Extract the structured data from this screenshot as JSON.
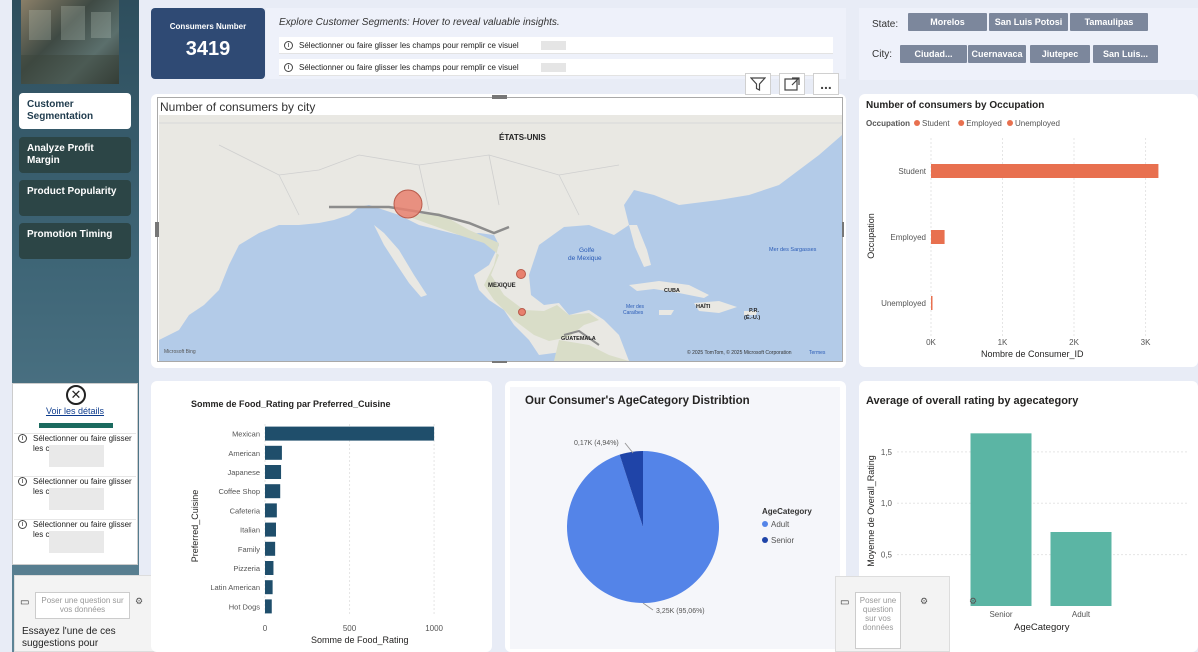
{
  "sidebar": {
    "nav": [
      {
        "label": "Customer Segmentation"
      },
      {
        "label": "Analyze Profit Margin"
      },
      {
        "label": "Product Popularity"
      },
      {
        "label": "Promotion Timing"
      }
    ],
    "details_link": "Voir les détails",
    "details_items": [
      "Sélectionner ou faire glisser les ch plir ce visu",
      "Sélectionner ou faire glisser les ch plir ce visu",
      "Sélectionner ou faire glisser les ch plir ce visu"
    ]
  },
  "kpi": {
    "label": "Consumers Number",
    "value": "3419"
  },
  "explore": {
    "text": "Explore Customer Segments: Hover to reveal valuable insights.",
    "rows": [
      "Sélectionner ou faire glisser les champs pour remplir ce visuel",
      "Sélectionner ou faire glisser les champs pour remplir ce visuel"
    ]
  },
  "slicers": {
    "state_label": "State:",
    "states": [
      "Morelos",
      "San Luis Potosi",
      "Tamaulipas"
    ],
    "city_label": "City:",
    "cities": [
      "Ciudad...",
      "Cuernavaca",
      "Jiutepec",
      "San Luis..."
    ]
  },
  "map": {
    "title": "Number of consumers by city",
    "labels": {
      "usa": "ÉTATS-UNIS",
      "mexico": "MEXIQUE",
      "cuba": "CUBA",
      "haiti": "HAÏTI",
      "pr": "P.R.",
      "pr2": "(É.-U.)",
      "guatemala": "GUATEMALA",
      "gulf1": "Golfe",
      "gulf2": "de Mexique",
      "sargasso": "Mer des Sargasses",
      "caribbean1": "Mer des",
      "caribbean2": "Caraïbes",
      "attribution": "© 2025 TomTom, © 2025 Microsoft Corporation",
      "terms": "Termes",
      "bing": "Microsoft Bing"
    },
    "toolbar": {
      "filter_icon": "filter-icon",
      "focus_icon": "focus-mode-icon",
      "more": "..."
    }
  },
  "occupation": {
    "title": "Number of consumers by Occupation",
    "legend_title": "Occupation",
    "accent": "#e8704f",
    "chart_data": {
      "type": "bar",
      "orientation": "horizontal",
      "categories": [
        "Student",
        "Employed",
        "Unemployed"
      ],
      "values": [
        3180,
        190,
        20
      ],
      "series": [
        {
          "name": "Student"
        },
        {
          "name": "Employed"
        },
        {
          "name": "Unemployed"
        }
      ],
      "xlabel": "Nombre de Consumer_ID",
      "ylabel": "Occupation",
      "xticks": [
        "0K",
        "1K",
        "2K",
        "3K"
      ],
      "xlim": [
        0,
        3300
      ]
    }
  },
  "food": {
    "title": "Somme de Food_Rating par Preferred_Cuisine",
    "color": "#1f4e6b",
    "chart_data": {
      "type": "bar",
      "orientation": "horizontal",
      "categories": [
        "Mexican",
        "American",
        "Japanese",
        "Coffee Shop",
        "Cafeteria",
        "Italian",
        "Family",
        "Pizzeria",
        "Latin American",
        "Hot Dogs"
      ],
      "values": [
        1000,
        100,
        95,
        90,
        70,
        65,
        60,
        50,
        45,
        40
      ],
      "xlabel": "Somme de Food_Rating",
      "ylabel": "Preferred_Cuisine",
      "xticks": [
        "0",
        "500",
        "1000"
      ],
      "xlim": [
        0,
        1100
      ]
    }
  },
  "age": {
    "title": "Our Consumer's AgeCategory Distribtion",
    "legend_title": "AgeCategory",
    "chart_data": {
      "type": "pie",
      "categories": [
        "Adult",
        "Senior"
      ],
      "values": [
        3250,
        170
      ],
      "percent": [
        95.06,
        4.94
      ],
      "labels": [
        "3,25K (95,06%)",
        "0,17K (4,94%)"
      ],
      "colors": [
        "#5484e8",
        "#1f44a8"
      ]
    }
  },
  "avg": {
    "title": "Average of overall rating by agecategory",
    "color": "#5bb5a4",
    "chart_data": {
      "type": "bar",
      "categories": [
        "Senior",
        "Adult"
      ],
      "values": [
        1.68,
        0.72
      ],
      "xlabel": "AgeCategory",
      "ylabel": "Moyenne de Overall_Rating",
      "yticks": [
        "0,5",
        "1,0",
        "1,5"
      ],
      "ylim": [
        0,
        1.8
      ]
    }
  },
  "qa": {
    "placeholder_left": "Poser une question sur vos données",
    "placeholder_right": "Poser une question sur vos données",
    "suggest": "Essayez l'une de ces suggestions pour"
  }
}
